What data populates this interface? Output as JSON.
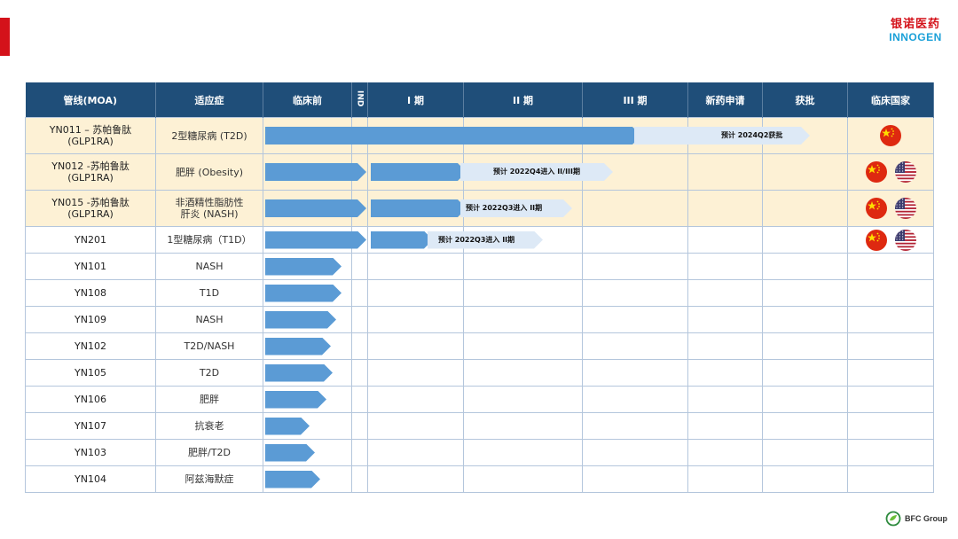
{
  "logo": {
    "cn": "银诺医药",
    "en": "INNOGEN"
  },
  "footer": {
    "brand": "BFC Group"
  },
  "table": {
    "headers": [
      "管线(MOA)",
      "适应症",
      "临床前",
      "IND",
      "I 期",
      "II 期",
      "III 期",
      "新药申请",
      "获批",
      "临床国家"
    ],
    "rows": [
      {
        "code_line1": "YN011 – 苏帕鲁肽",
        "code_line2": "(GLP1RA)",
        "indication_line1": "2型糖尿病 (T2D)",
        "indication_line2": "",
        "progress_stage_end": 4.85,
        "ongoing": [
          0,
          3.85
        ],
        "planned": [
          3.85,
          4.85
        ],
        "annotation": "预计 2024Q2获批",
        "flags": [
          "cn"
        ]
      },
      {
        "code_line1": "YN012 -苏帕鲁肽",
        "code_line2": "(GLP1RA)",
        "indication_line1": "肥胖 (Obesity)",
        "indication_line2": "",
        "ongoing_segments": [
          [
            0,
            1
          ],
          [
            1,
            2
          ]
        ],
        "planned": [
          2,
          3.3
        ],
        "annotation": "预计 2022Q4进入 II/III期",
        "flags": [
          "cn",
          "us"
        ]
      },
      {
        "code_line1": "YN015 -苏帕鲁肽",
        "code_line2": "(GLP1RA)",
        "indication_line1": "非酒精性脂肪性",
        "indication_line2": "肝炎 (NASH)",
        "annotation": "预计 2022Q3进入 II期",
        "flags": [
          "cn",
          "us"
        ]
      },
      {
        "code_line1": "YN201",
        "code_line2": "",
        "indication_line1": "1型糖尿病（T1D）",
        "indication_line2": "",
        "annotation": "预计 2022Q3进入 II期",
        "flags": [
          "cn",
          "us"
        ]
      },
      {
        "code_line1": "YN101",
        "code_line2": "",
        "indication_line1": "NASH",
        "indication_line2": "",
        "preclinical_progress": 0.86,
        "flags": []
      },
      {
        "code_line1": "YN108",
        "code_line2": "",
        "indication_line1": "T1D",
        "indication_line2": "",
        "preclinical_progress": 0.86,
        "flags": []
      },
      {
        "code_line1": "YN109",
        "code_line2": "",
        "indication_line1": "NASH",
        "indication_line2": "",
        "preclinical_progress": 0.8,
        "flags": []
      },
      {
        "code_line1": "YN102",
        "code_line2": "",
        "indication_line1": "T2D/NASH",
        "indication_line2": "",
        "preclinical_progress": 0.74,
        "flags": []
      },
      {
        "code_line1": "YN105",
        "code_line2": "",
        "indication_line1": "T2D",
        "indication_line2": "",
        "preclinical_progress": 0.76,
        "flags": []
      },
      {
        "code_line1": "YN106",
        "code_line2": "",
        "indication_line1": "肥胖",
        "indication_line2": "",
        "preclinical_progress": 0.69,
        "flags": []
      },
      {
        "code_line1": "YN107",
        "code_line2": "",
        "indication_line1": "抗衰老",
        "indication_line2": "",
        "preclinical_progress": 0.5,
        "flags": []
      },
      {
        "code_line1": "YN103",
        "code_line2": "",
        "indication_line1": "肥胖/T2D",
        "indication_line2": "",
        "preclinical_progress": 0.56,
        "flags": []
      },
      {
        "code_line1": "YN104",
        "code_line2": "",
        "indication_line1": "阿兹海默症",
        "indication_line2": "",
        "preclinical_progress": 0.62,
        "flags": []
      }
    ]
  },
  "colors": {
    "header_bg": "#1f4e79",
    "bar_ongoing": "#5b9bd5",
    "bar_planned": "#dde9f6",
    "row_highlight": "#fdf1d5",
    "brand_red": "#d4121a",
    "brand_blue": "#1aa0d8"
  }
}
